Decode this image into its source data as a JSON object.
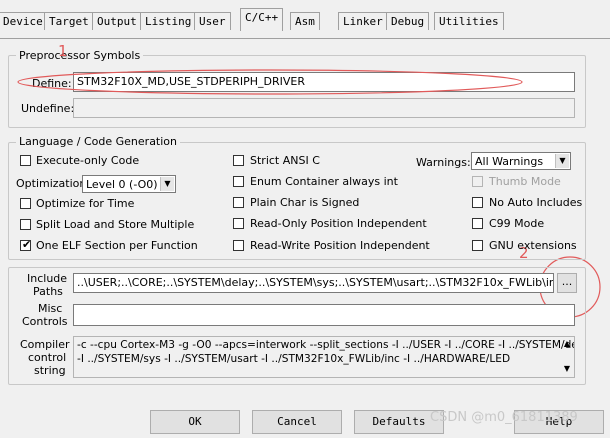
{
  "tabs": [
    "Device",
    "Target",
    "Output",
    "Listing",
    "User",
    "C/C++",
    "Asm",
    "Linker",
    "Debug",
    "Utilities"
  ],
  "active_tab": "C/C++",
  "preprocessor": {
    "title": "Preprocessor Symbols",
    "define_label": "Define:",
    "define_value": "STM32F10X_MD,USE_STDPERIPH_DRIVER",
    "undefine_label": "Undefine:",
    "undefine_value": ""
  },
  "language": {
    "title": "Language / Code Generation",
    "execute_only": "Execute-only Code",
    "optimization_label": "Optimization:",
    "optimization_value": "Level 0 (-O0)",
    "optimize_time": "Optimize for Time",
    "split_load": "Split Load and Store Multiple",
    "one_elf": "One ELF Section per Function",
    "strict_ansi": "Strict ANSI C",
    "enum_container": "Enum Container always int",
    "plain_char": "Plain Char is Signed",
    "ro_pos": "Read-Only Position Independent",
    "rw_pos": "Read-Write Position Independent",
    "warnings_label": "Warnings:",
    "warnings_value": "All Warnings",
    "thumb_mode": "Thumb Mode",
    "no_auto_includes": "No Auto Includes",
    "c99_mode": "C99 Mode",
    "gnu_extensions": "GNU extensions"
  },
  "include_paths": {
    "label_1": "Include",
    "label_2": "Paths",
    "value": "..\\USER;..\\CORE;..\\SYSTEM\\delay;..\\SYSTEM\\sys;..\\SYSTEM\\usart;..\\STM32F10x_FWLib\\inc;..\\",
    "browse_label": "..."
  },
  "misc_controls": {
    "label_1": "Misc",
    "label_2": "Controls",
    "value": ""
  },
  "compiler_string": {
    "label_1": "Compiler",
    "label_2": "control",
    "label_3": "string",
    "line_1": "-c --cpu Cortex-M3 -g -O0 --apcs=interwork --split_sections -I ../USER -I ../CORE -I ../SYSTEM/delay",
    "line_2": "-I ../SYSTEM/sys -I ../SYSTEM/usart -I ../STM32F10x_FWLib/inc -I ../HARDWARE/LED"
  },
  "buttons": {
    "ok": "OK",
    "cancel": "Cancel",
    "defaults": "Defaults",
    "help": "Help"
  },
  "annotations": {
    "num_1": "1",
    "num_2": "2"
  },
  "watermark": "CSDN @m0_61811389",
  "colors": {
    "annotation": "#e15a5a"
  }
}
